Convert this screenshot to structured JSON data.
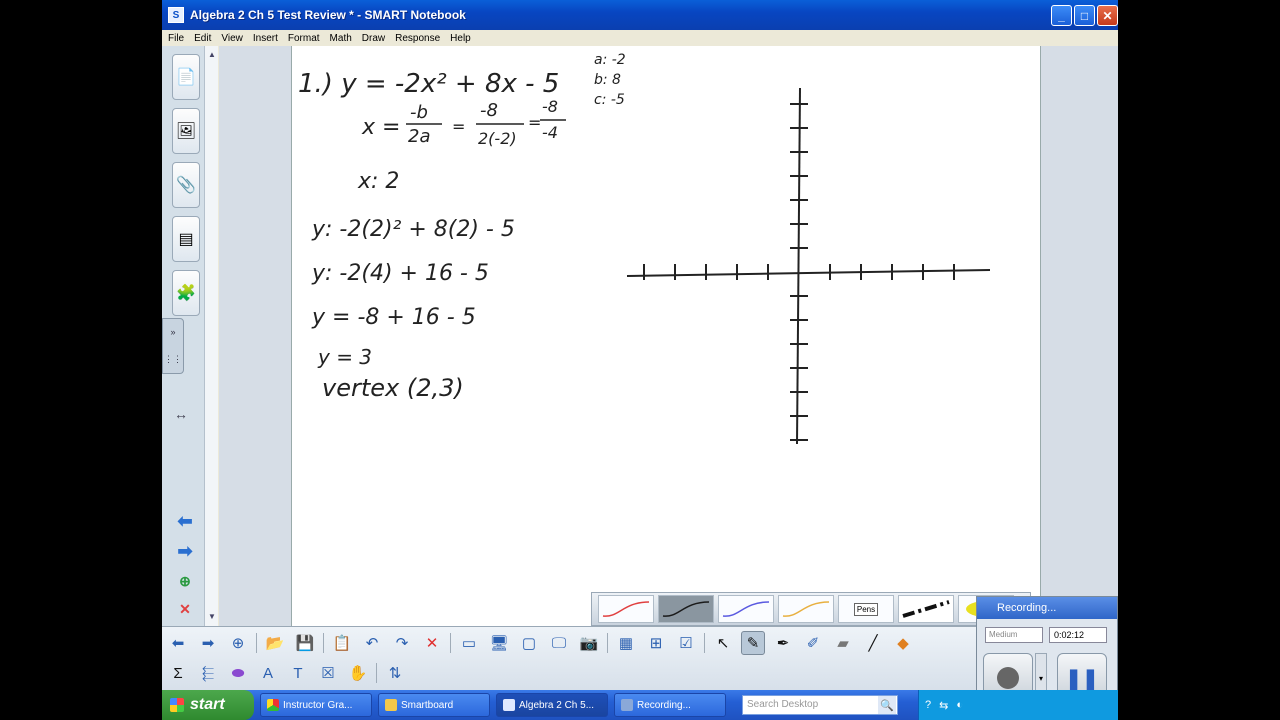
{
  "window": {
    "title": "Algebra 2 Ch 5 Test Review * - SMART Notebook",
    "icon": "smart-notebook-icon"
  },
  "menu": [
    "File",
    "Edit",
    "View",
    "Insert",
    "Format",
    "Math",
    "Draw",
    "Response",
    "Help"
  ],
  "side_tabs": [
    "page-sorter-icon",
    "gallery-icon",
    "attachments-icon",
    "properties-icon",
    "addons-icon"
  ],
  "side_controls": {
    "collapse": "»",
    "resize": "↔"
  },
  "ink": {
    "line1": "1.) y = -2x² + 8x - 5",
    "coef_a": "a: -2",
    "coef_b": "b: 8",
    "coef_c": "c: -5",
    "vertex_x_formula_lhs": "x =",
    "frac1_num": "-b",
    "frac1_den": "2a",
    "frac2_num": "-8",
    "frac2_den": "2(-2)",
    "frac3_num": "-8",
    "frac3_den": "-4",
    "x_result": "x: 2",
    "step1": "y: -2(2)² + 8(2) - 5",
    "step2": "y: -2(4) + 16 - 5",
    "step3": "y = -8 + 16 - 5",
    "step4": "y = 3",
    "vertex": "vertex (2,3)"
  },
  "pen_tray": {
    "pens_label": "Pens",
    "swatch_colors": [
      "#e04040",
      "#2a2a2a",
      "#5a5ae0",
      "#e8b040"
    ]
  },
  "recording": {
    "title": "Recording...",
    "quality": "Medium",
    "elapsed": "0:02:12"
  },
  "toolbar_row1": [
    "back-icon",
    "forward-icon",
    "add-page-icon",
    "open-icon",
    "save-icon",
    "paste-icon",
    "undo-icon",
    "redo-icon",
    "delete-icon",
    "screen-shade-icon",
    "full-screen-icon",
    "transparent-bg-icon",
    "display-icon",
    "document-camera-icon",
    "table-icon",
    "insert-icon",
    "response-icon",
    "select-icon",
    "pen-icon",
    "creative-pen-icon",
    "magic-pen-icon",
    "eraser-icon",
    "line-icon",
    "shapes-icon"
  ],
  "toolbar_row2": [
    "math-icon",
    "measure-icon",
    "eraser-icon",
    "text-icon",
    "fill-icon",
    "properties-icon",
    "move-toolbar-icon"
  ],
  "taskbar": {
    "start": "start",
    "items": [
      "Instructor Gra...",
      "Smartboard",
      "Algebra 2 Ch 5...",
      "Recording..."
    ],
    "active_index": 2,
    "search_placeholder": "Search Desktop"
  }
}
